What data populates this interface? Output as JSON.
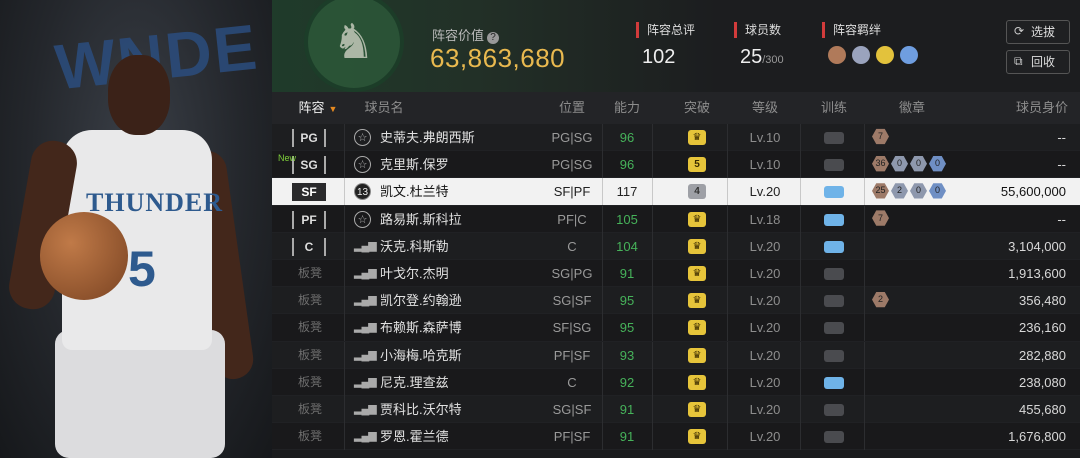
{
  "header": {
    "value_label": "阵容价值",
    "value": "63,863,680",
    "rating_label": "阵容总评",
    "rating": "102",
    "players_label": "球员数",
    "players": "25",
    "players_max": "/300",
    "chem_label": "阵容羁绊",
    "select_button": "选拔",
    "recycle_button": "回收"
  },
  "art": {
    "bg_text": "WNDE",
    "jersey_text": "THUNDER",
    "jersey_number": "5"
  },
  "columns": {
    "lineup": "阵容",
    "name": "球员名",
    "position": "位置",
    "ability": "能力",
    "breakthrough": "突破",
    "level": "等级",
    "training": "训练",
    "badges": "徽章",
    "value": "球员身价"
  },
  "new_tag": "New",
  "rows": [
    {
      "slot": "PG",
      "bench": false,
      "icon": "star",
      "name": "史蒂夫.弗朗西斯",
      "position": "PG|SG",
      "ability": "96",
      "ability_color": "green",
      "break": "crown",
      "level": "Lv.10",
      "train": false,
      "badges": [
        {
          "t": "bronze",
          "v": "7"
        }
      ],
      "value": "--"
    },
    {
      "slot": "SG",
      "bench": false,
      "new": true,
      "icon": "star",
      "name": "克里斯.保罗",
      "position": "PG|SG",
      "ability": "96",
      "ability_color": "green",
      "break": "5",
      "level": "Lv.10",
      "train": false,
      "badges": [
        {
          "t": "bronze",
          "v": "36"
        },
        {
          "t": "silver",
          "v": "0"
        },
        {
          "t": "silver",
          "v": "0"
        },
        {
          "t": "blue",
          "v": "0"
        }
      ],
      "value": "--"
    },
    {
      "slot": "SF",
      "bench": false,
      "selected": true,
      "icon": "ring",
      "icon_text": "13",
      "name": "凯文.杜兰特",
      "position": "SF|PF",
      "ability": "117",
      "ability_color": "",
      "break": "4",
      "break_grey": true,
      "level": "Lv.20",
      "train": true,
      "badges": [
        {
          "t": "bronze",
          "v": "25"
        },
        {
          "t": "silver",
          "v": "2"
        },
        {
          "t": "silver",
          "v": "0"
        },
        {
          "t": "blue",
          "v": "0"
        }
      ],
      "value": "55,600,000"
    },
    {
      "slot": "PF",
      "bench": false,
      "icon": "star",
      "name": "路易斯.斯科拉",
      "position": "PF|C",
      "ability": "105",
      "ability_color": "green",
      "break": "crown",
      "level": "Lv.18",
      "train": true,
      "badges": [
        {
          "t": "bronze",
          "v": "7"
        }
      ],
      "value": "--"
    },
    {
      "slot": "C",
      "bench": false,
      "icon": "bars",
      "name": "沃克.科斯勒",
      "position": "C",
      "ability": "104",
      "ability_color": "green",
      "break": "crown",
      "level": "Lv.20",
      "train": true,
      "badges": [],
      "value": "3,104,000"
    },
    {
      "slot": "板凳",
      "bench": true,
      "icon": "bars",
      "name": "叶戈尔.杰明",
      "position": "SG|PG",
      "ability": "91",
      "ability_color": "green",
      "break": "crown",
      "level": "Lv.20",
      "train": false,
      "badges": [],
      "value": "1,913,600"
    },
    {
      "slot": "板凳",
      "bench": true,
      "icon": "bars",
      "name": "凯尔登.约翰逊",
      "position": "SG|SF",
      "ability": "95",
      "ability_color": "green",
      "break": "crown",
      "level": "Lv.20",
      "train": false,
      "badges": [
        {
          "t": "bronze",
          "v": "2"
        }
      ],
      "value": "356,480"
    },
    {
      "slot": "板凳",
      "bench": true,
      "icon": "bars",
      "name": "布赖斯.森萨博",
      "position": "SF|SG",
      "ability": "95",
      "ability_color": "green",
      "break": "crown",
      "level": "Lv.20",
      "train": false,
      "badges": [],
      "value": "236,160"
    },
    {
      "slot": "板凳",
      "bench": true,
      "icon": "bars",
      "name": "小海梅.哈克斯",
      "position": "PF|SF",
      "ability": "93",
      "ability_color": "green",
      "break": "crown",
      "level": "Lv.20",
      "train": false,
      "badges": [],
      "value": "282,880"
    },
    {
      "slot": "板凳",
      "bench": true,
      "icon": "bars",
      "name": "尼克.理查兹",
      "position": "C",
      "ability": "92",
      "ability_color": "green",
      "break": "crown",
      "level": "Lv.20",
      "train": true,
      "badges": [],
      "value": "238,080"
    },
    {
      "slot": "板凳",
      "bench": true,
      "icon": "bars",
      "name": "贾科比.沃尔特",
      "position": "SG|SF",
      "ability": "91",
      "ability_color": "green",
      "break": "crown",
      "level": "Lv.20",
      "train": false,
      "badges": [],
      "value": "455,680"
    },
    {
      "slot": "板凳",
      "bench": true,
      "icon": "bars",
      "name": "罗恩.霍兰德",
      "position": "PF|SF",
      "ability": "91",
      "ability_color": "green",
      "break": "crown",
      "level": "Lv.20",
      "train": false,
      "badges": [],
      "value": "1,676,800"
    }
  ],
  "colors": {
    "gold": "#e9b94f",
    "accent_red": "#d23b3b",
    "green": "#46b25a",
    "sort_orange": "#e68a20"
  }
}
